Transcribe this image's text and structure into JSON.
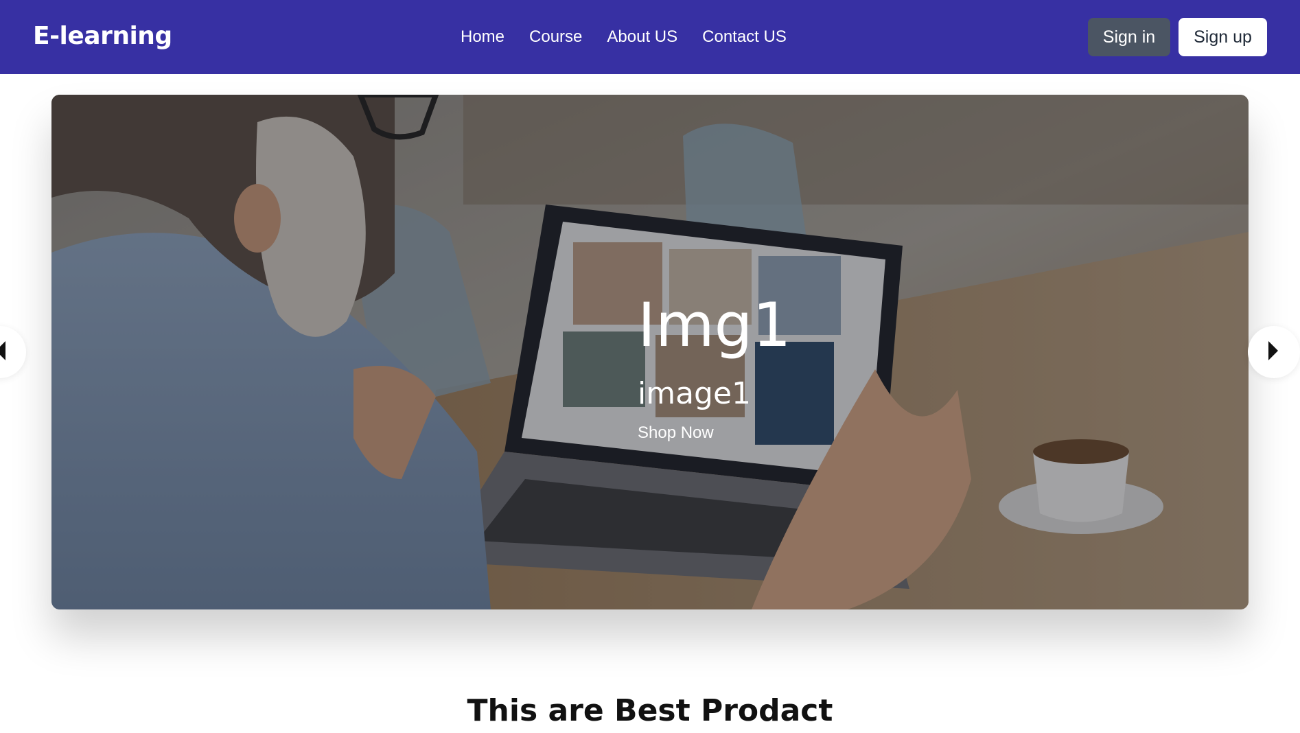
{
  "brand": "E-learning",
  "nav": {
    "links": [
      "Home",
      "Course",
      "About US",
      "Contact US"
    ],
    "signin_label": "Sign in",
    "signup_label": "Sign up"
  },
  "carousel": {
    "title": "Img1",
    "subtitle": "image1",
    "link_label": "Shop Now",
    "prev_icon": "chevron-left-icon",
    "next_icon": "chevron-right-icon"
  },
  "section": {
    "title": "This are Best Prodact"
  },
  "colors": {
    "navbar": "#3730a3",
    "signin_bg": "#4b5563",
    "signup_bg": "#ffffff"
  }
}
